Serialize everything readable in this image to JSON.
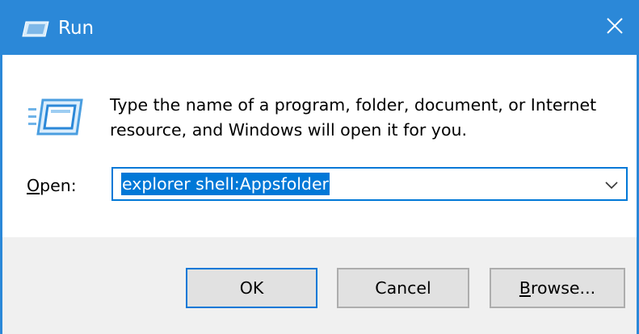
{
  "window": {
    "title": "Run",
    "accent_color": "#2b88d8"
  },
  "title_icon": "run-icon",
  "close_icon": "close-icon",
  "description": "Type the name of a program, folder, document, or Internet resource, and Windows will open it for you.",
  "open_field": {
    "label": "Open:",
    "value": "explorer shell:Appsfolder",
    "dropdown_icon": "chevron-down-icon",
    "selection_color": "#0078d7"
  },
  "buttons": {
    "ok": "OK",
    "cancel": "Cancel",
    "browse": "Browse..."
  }
}
